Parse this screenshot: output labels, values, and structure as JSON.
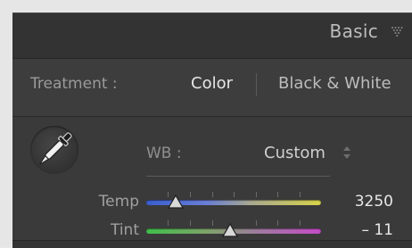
{
  "panel": {
    "title": "Basic"
  },
  "treatment": {
    "label": "Treatment :",
    "options": [
      "Color",
      "Black & White"
    ],
    "selected": "Color"
  },
  "white_balance": {
    "label": "WB :",
    "value": "Custom",
    "eyedropper_icon": "eyedropper-icon"
  },
  "sliders": {
    "temp": {
      "label": "Temp",
      "value": "3250"
    },
    "tint": {
      "label": "Tint",
      "value": "– 11"
    }
  },
  "colors": {
    "panel_bg": "#3b3b3b",
    "text_active": "#e6e6e6",
    "text_dim": "#9a9a9a"
  }
}
